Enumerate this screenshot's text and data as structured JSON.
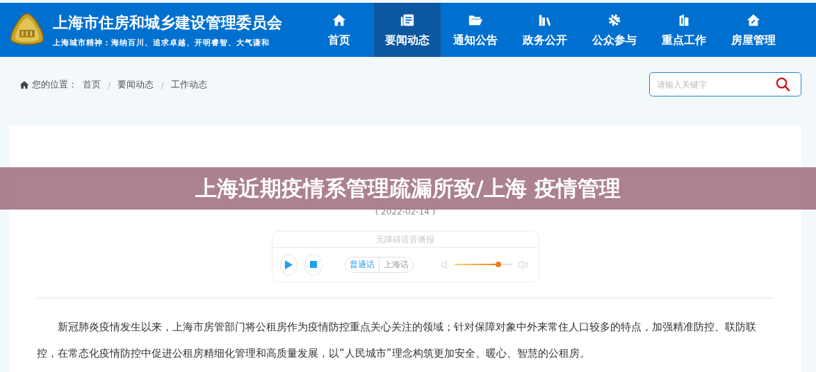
{
  "header": {
    "site_title": "上海市住房和城乡建设管理委员会",
    "slogan": "上海城市精神：海纳百川、追求卓越、开明睿智、大气谦和"
  },
  "nav": [
    {
      "label": "首页",
      "kind": "home",
      "selected": false
    },
    {
      "label": "要闻动态",
      "kind": "news",
      "selected": true
    },
    {
      "label": "通知公告",
      "kind": "folder",
      "selected": false
    },
    {
      "label": "政务公开",
      "kind": "books",
      "selected": false
    },
    {
      "label": "公众参与",
      "kind": "gear",
      "selected": false
    },
    {
      "label": "重点工作",
      "kind": "building",
      "selected": false
    },
    {
      "label": "房屋管理",
      "kind": "house",
      "selected": false
    }
  ],
  "breadcrumb": {
    "label": "您的位置：",
    "items": [
      "首页",
      "要闻动态",
      "工作动态"
    ],
    "separator": "/"
  },
  "search": {
    "placeholder": "请输入关键字"
  },
  "overlay_title": "上海近期疫情系管理疏漏所致/上海 疫情管理",
  "article": {
    "date": "( 2022-02-14 )",
    "audio": {
      "title": "无障碍语音播报",
      "languages": [
        {
          "label": "普通话",
          "selected": true
        },
        {
          "label": "上海话",
          "selected": false
        }
      ],
      "volume": {
        "level": 0.76
      }
    },
    "paragraphs": [
      "新冠肺炎疫情发生以来，上海市房管部门将公租房作为疫情防控重点关心关注的领域；针对保障对象中外来常住人口较多的特点，加强精准防控、联防联控，在常态化疫情防控中促进公租房精细化管理和高质量发展，以“人民城市”理念构筑更加安全、暖心、智慧的公租房。"
    ]
  }
}
